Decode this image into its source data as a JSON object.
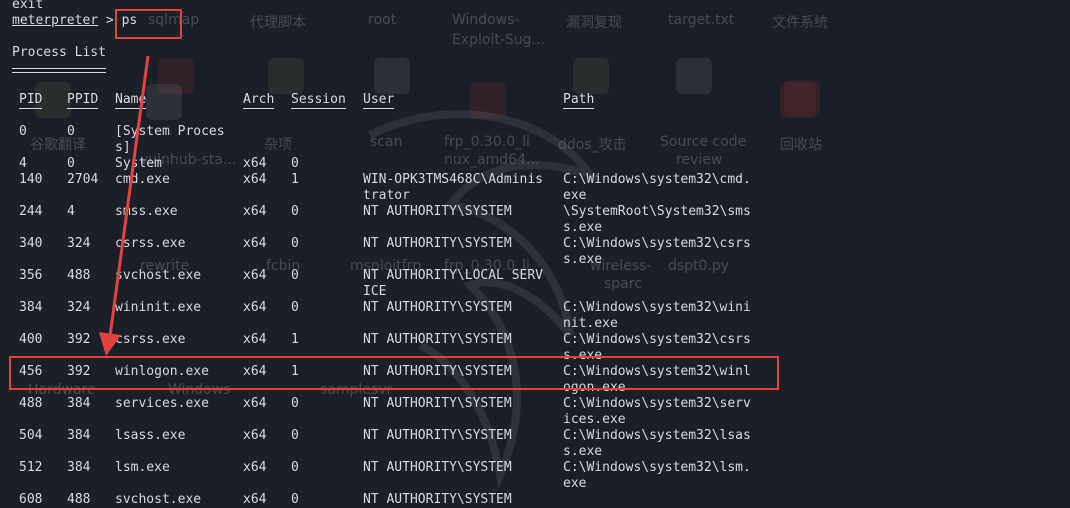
{
  "desktop": {
    "labels": [
      "sqlmap",
      "代理脚本",
      "root",
      "Windows-",
      "Exploit-Sug...",
      "漏洞复现",
      "target.txt",
      "文件系统",
      "谷歌翻译",
      "vulnhub-sta...",
      "杂项",
      "scan",
      "frp_0.30.0_li",
      "nux_amd64...",
      "ddos_攻击",
      "Source code",
      "review",
      "回收站",
      "rewrite",
      "fcbin",
      "msploitfrp",
      "frp_0.30.0_li",
      "wireless-",
      "sparc",
      "dspt0.py",
      "Hardware",
      "Windows",
      "samplesvr"
    ]
  },
  "terminal": {
    "lines": [
      "exit"
    ],
    "prompt_name": "meterpreter",
    "prompt_sep": " > ",
    "command": "ps",
    "title": "Process List",
    "headers": {
      "pid": "PID",
      "ppid": "PPID",
      "name": "Name",
      "arch": "Arch",
      "session": "Session",
      "user": "User",
      "path": "Path"
    },
    "rows": [
      {
        "pid": "0",
        "ppid": "0",
        "name": "[System Proces\ns]",
        "arch": "",
        "session": "",
        "user": "",
        "path": ""
      },
      {
        "pid": "4",
        "ppid": "0",
        "name": "System",
        "arch": "x64",
        "session": "0",
        "user": "",
        "path": ""
      },
      {
        "pid": "140",
        "ppid": "2704",
        "name": "cmd.exe",
        "arch": "x64",
        "session": "1",
        "user": "WIN-OPK3TMS468C\\Adminis\ntrator",
        "path": "C:\\Windows\\system32\\cmd.\nexe"
      },
      {
        "pid": "244",
        "ppid": "4",
        "name": "smss.exe",
        "arch": "x64",
        "session": "0",
        "user": "NT AUTHORITY\\SYSTEM",
        "path": "\\SystemRoot\\System32\\sms\ns.exe"
      },
      {
        "pid": "340",
        "ppid": "324",
        "name": "csrss.exe",
        "arch": "x64",
        "session": "0",
        "user": "NT AUTHORITY\\SYSTEM",
        "path": "C:\\Windows\\system32\\csrs\ns.exe"
      },
      {
        "pid": "356",
        "ppid": "488",
        "name": "svchost.exe",
        "arch": "x64",
        "session": "0",
        "user": "NT AUTHORITY\\LOCAL SERV\nICE",
        "path": ""
      },
      {
        "pid": "384",
        "ppid": "324",
        "name": "wininit.exe",
        "arch": "x64",
        "session": "0",
        "user": "NT AUTHORITY\\SYSTEM",
        "path": "C:\\Windows\\system32\\wini\nnit.exe"
      },
      {
        "pid": "400",
        "ppid": "392",
        "name": "csrss.exe",
        "arch": "x64",
        "session": "1",
        "user": "NT AUTHORITY\\SYSTEM",
        "path": "C:\\Windows\\system32\\csrs\ns.exe"
      },
      {
        "pid": "456",
        "ppid": "392",
        "name": "winlogon.exe",
        "arch": "x64",
        "session": "1",
        "user": "NT AUTHORITY\\SYSTEM",
        "path": "C:\\Windows\\system32\\winl\nogon.exe"
      },
      {
        "pid": "488",
        "ppid": "384",
        "name": "services.exe",
        "arch": "x64",
        "session": "0",
        "user": "NT AUTHORITY\\SYSTEM",
        "path": "C:\\Windows\\system32\\serv\nices.exe"
      },
      {
        "pid": "504",
        "ppid": "384",
        "name": "lsass.exe",
        "arch": "x64",
        "session": "0",
        "user": "NT AUTHORITY\\SYSTEM",
        "path": "C:\\Windows\\system32\\lsas\ns.exe"
      },
      {
        "pid": "512",
        "ppid": "384",
        "name": "lsm.exe",
        "arch": "x64",
        "session": "0",
        "user": "NT AUTHORITY\\SYSTEM",
        "path": "C:\\Windows\\system32\\lsm.\nexe"
      },
      {
        "pid": "608",
        "ppid": "488",
        "name": "svchost.exe",
        "arch": "x64",
        "session": "0",
        "user": "NT AUTHORITY\\SYSTEM",
        "path": ""
      }
    ]
  },
  "annotation": {
    "color": "#e2433f",
    "highlighted_command": "ps",
    "highlighted_pid": "456"
  }
}
